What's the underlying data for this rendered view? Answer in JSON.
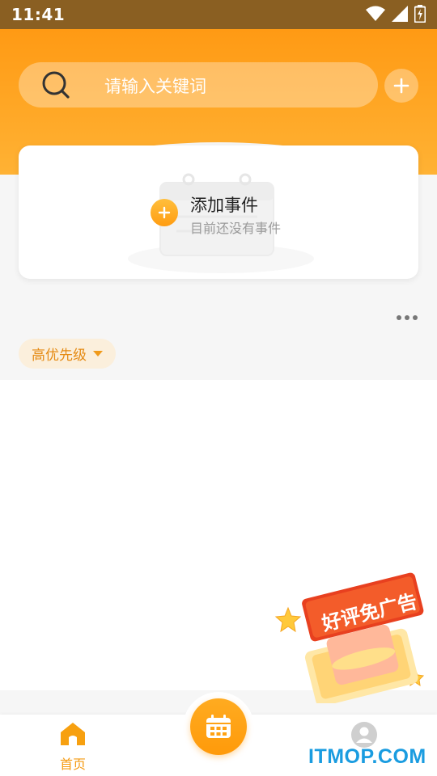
{
  "status_bar": {
    "time": "11:41",
    "icons": [
      "wifi-icon",
      "signal-icon",
      "battery-icon"
    ]
  },
  "search": {
    "placeholder": "请输入关键词",
    "icon": "search-icon"
  },
  "header": {
    "add_icon": "plus-icon",
    "accent": "#ff9a14"
  },
  "event_card": {
    "title": "添加事件",
    "subtitle": "目前还没有事件",
    "icon": "plus-circle-icon"
  },
  "filter": {
    "priority_label": "高优先级",
    "more_icon": "more-dots-icon"
  },
  "promo": {
    "text": "好评免广告"
  },
  "tab_bar": {
    "home_label": "首页",
    "center_icon": "calendar-icon",
    "mine_icon": "user-icon"
  },
  "watermark": "ITMOP.COM"
}
